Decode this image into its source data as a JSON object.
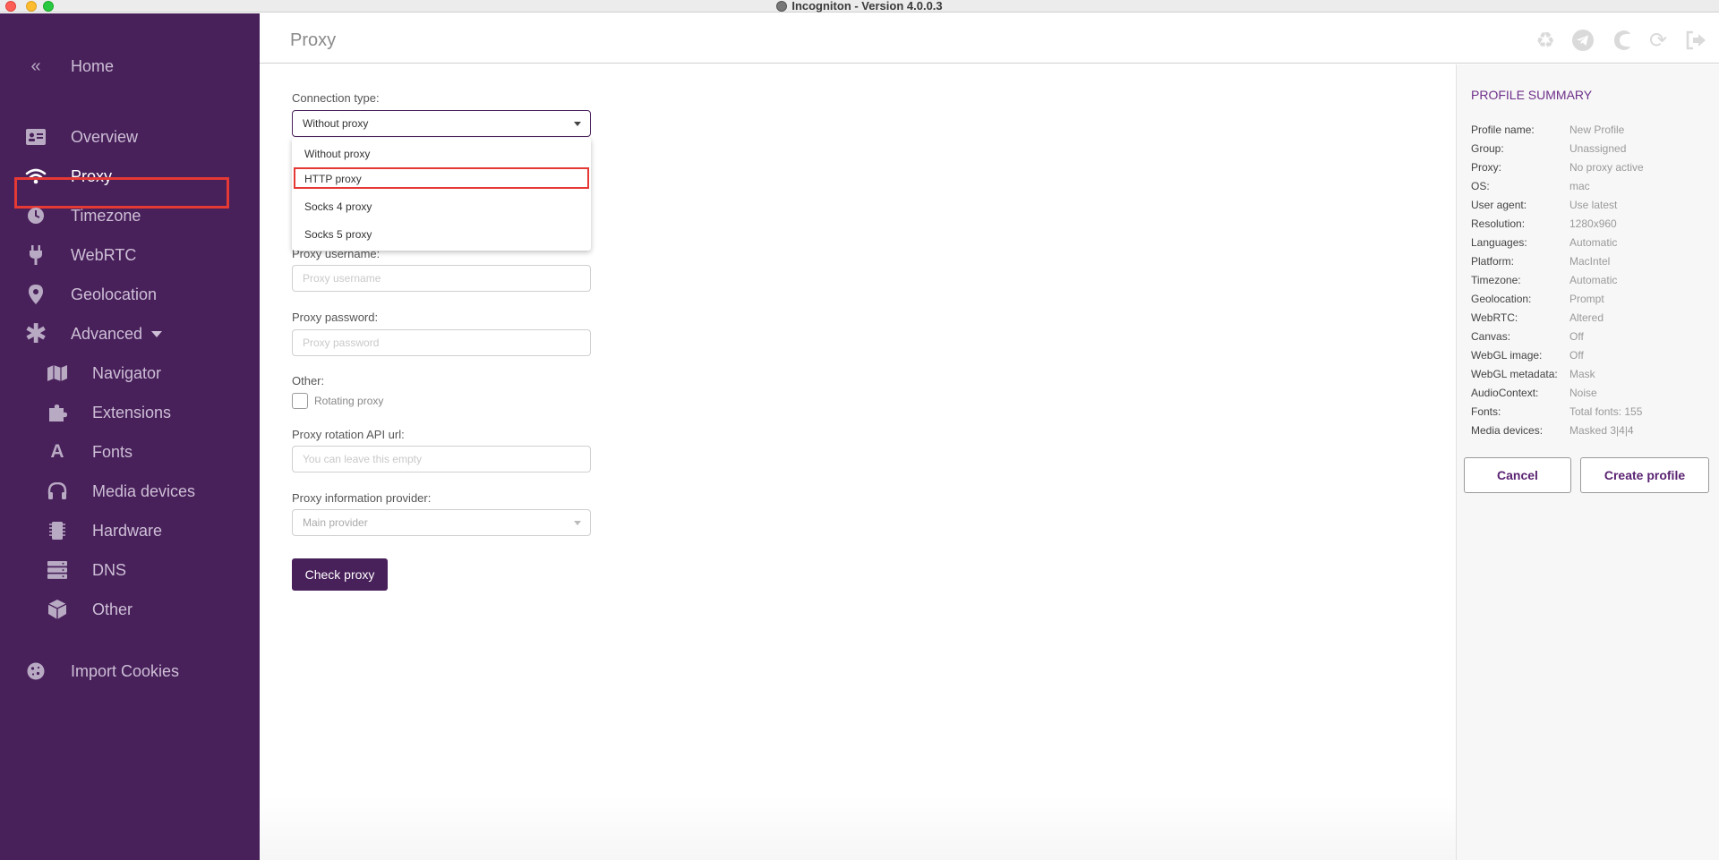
{
  "window": {
    "title": "Incogniton - Version 4.0.0.3"
  },
  "sidebar": {
    "items": [
      {
        "label": "Home",
        "icon": "double-chevron-left-icon"
      },
      {
        "label": "Overview",
        "icon": "id-card-icon"
      },
      {
        "label": "Proxy",
        "icon": "wifi-icon"
      },
      {
        "label": "Timezone",
        "icon": "clock-icon"
      },
      {
        "label": "WebRTC",
        "icon": "plug-icon"
      },
      {
        "label": "Geolocation",
        "icon": "map-pin-icon"
      },
      {
        "label": "Advanced",
        "icon": "asterisk-icon"
      },
      {
        "label": "Navigator",
        "icon": "map-icon"
      },
      {
        "label": "Extensions",
        "icon": "puzzle-icon"
      },
      {
        "label": "Fonts",
        "icon": "font-icon"
      },
      {
        "label": "Media devices",
        "icon": "headphones-icon"
      },
      {
        "label": "Hardware",
        "icon": "chip-icon"
      },
      {
        "label": "DNS",
        "icon": "server-icon"
      },
      {
        "label": "Other",
        "icon": "cube-icon"
      },
      {
        "label": "Import Cookies",
        "icon": "cookie-icon"
      }
    ],
    "active": "Proxy"
  },
  "header": {
    "title": "Proxy",
    "icons": [
      "recycle-icon",
      "telegram-icon",
      "moon-icon",
      "refresh-icon",
      "sign-out-icon"
    ]
  },
  "form": {
    "connection_type_label": "Connection type:",
    "connection_type_value": "Without proxy",
    "dropdown_options": [
      "Without proxy",
      "HTTP proxy",
      "Socks 4 proxy",
      "Socks 5 proxy"
    ],
    "highlighted_option": "HTTP proxy",
    "username_label": "Proxy username:",
    "username_placeholder": "Proxy username",
    "password_label": "Proxy password:",
    "password_placeholder": "Proxy password",
    "other_label": "Other:",
    "rotating_label": "Rotating proxy",
    "rotating_checked": false,
    "rotation_url_label": "Proxy rotation API url:",
    "rotation_url_placeholder": "You can leave this empty",
    "info_provider_label": "Proxy information provider:",
    "info_provider_value": "Main provider",
    "check_button": "Check proxy"
  },
  "summary": {
    "title": "PROFILE SUMMARY",
    "rows": [
      {
        "key": "Profile name:",
        "value": "New Profile"
      },
      {
        "key": "Group:",
        "value": "Unassigned"
      },
      {
        "key": "Proxy:",
        "value": "No proxy active"
      },
      {
        "key": "OS:",
        "value": "mac"
      },
      {
        "key": "User agent:",
        "value": "Use latest"
      },
      {
        "key": "Resolution:",
        "value": "1280x960"
      },
      {
        "key": "Languages:",
        "value": "Automatic"
      },
      {
        "key": "Platform:",
        "value": "MacIntel"
      },
      {
        "key": "Timezone:",
        "value": "Automatic"
      },
      {
        "key": "Geolocation:",
        "value": "Prompt"
      },
      {
        "key": "WebRTC:",
        "value": "Altered"
      },
      {
        "key": "Canvas:",
        "value": "Off"
      },
      {
        "key": "WebGL image:",
        "value": "Off"
      },
      {
        "key": "WebGL metadata:",
        "value": "Mask"
      },
      {
        "key": "AudioContext:",
        "value": "Noise"
      },
      {
        "key": "Fonts:",
        "value": "Total fonts: 155"
      },
      {
        "key": "Media devices:",
        "value": "Masked 3|4|4"
      }
    ],
    "cancel_button": "Cancel",
    "create_button": "Create profile"
  },
  "colors": {
    "sidebar_bg": "#48205a",
    "accent": "#48205a",
    "summary_title": "#6d2f8a",
    "highlight": "#e53935"
  }
}
